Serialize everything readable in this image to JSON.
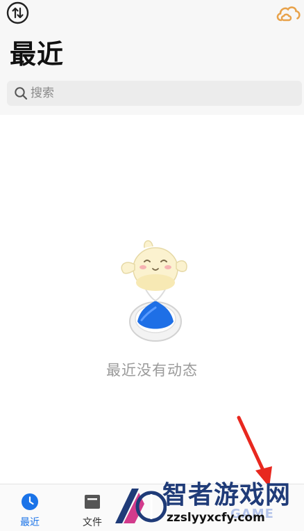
{
  "header": {
    "title": "最近",
    "left_icon": "sort-arrows-circle-icon",
    "right_icon": "cloud-icon"
  },
  "search": {
    "placeholder": "搜索",
    "value": ""
  },
  "empty_state": {
    "message": "最近没有动态",
    "illustration": "hourglass-mascot"
  },
  "bottom_nav": {
    "items": [
      {
        "label": "最近",
        "icon": "clock-icon",
        "active": true
      },
      {
        "label": "文件",
        "icon": "folder-icon",
        "active": false
      }
    ]
  },
  "watermark": {
    "title": "智者游戏网",
    "url": "zzslyyxcfy.com",
    "game_text": "GAME"
  },
  "colors": {
    "accent": "#1a73e8",
    "header_bg": "#f7f7f7",
    "search_bg": "#ececec",
    "arrow": "#e8281f",
    "cloud": "#e8a24a"
  }
}
